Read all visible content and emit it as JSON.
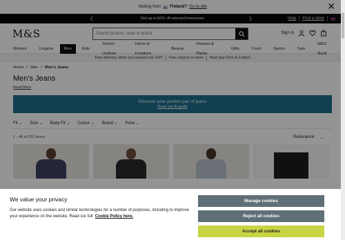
{
  "visit_bar": {
    "text": "Visiting from",
    "country": "Finland?",
    "link": "Go to site"
  },
  "promo": {
    "text": "Get up to 50% off selected homeware",
    "help": "Help",
    "find_store": "Find a store"
  },
  "header": {
    "logo": "M&S",
    "search_placeholder": "Search product, code or brand",
    "sign_in": "Sign in",
    "basket_count": "0"
  },
  "nav": {
    "items": [
      "Women",
      "Lingerie",
      "Men",
      "Kids",
      "School Uniform",
      "Home & Furniture",
      "Beauty",
      "Flowers & Plants",
      "Gifts",
      "Food",
      "Sports",
      "Sale",
      "M&S Bank"
    ],
    "active_index": 2
  },
  "delivery": {
    "items": [
      "Free delivery when you spend over £60*",
      "Free returns in-store",
      "Next day Click & Collect"
    ]
  },
  "breadcrumb": [
    "Home",
    "Men",
    "Men's Jeans"
  ],
  "page": {
    "title": "Men's Jeans",
    "read_more": "Read More"
  },
  "banner": {
    "title": "Discover your perfect pair of jeans",
    "link": "Read our fit guide"
  },
  "filters": [
    "Fit",
    "Size",
    "Body Fit",
    "Colour",
    "Brand",
    "Price"
  ],
  "results": {
    "count": "1 - 48 of 231 Items",
    "sort_label": "Relevance",
    "sort_arrow": "⌄"
  },
  "cookie": {
    "title": "We value your privacy",
    "body": "Our website uses cookies and similar technologies for a number of purposes, including to improve your experience on the website. Read our full",
    "policy_link": "Cookie Policy here.",
    "manage": "Manage cookies",
    "reject": "Reject all cookies",
    "accept": "Accept all cookies"
  }
}
